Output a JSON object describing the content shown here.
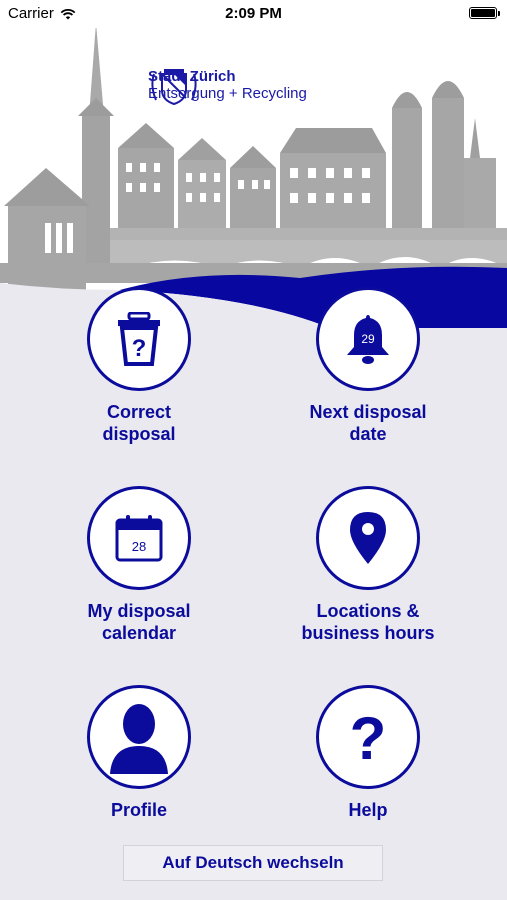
{
  "status_bar": {
    "carrier": "Carrier",
    "time": "2:09 PM"
  },
  "header": {
    "title": "Stadt Zürich",
    "subtitle": "Entsorgung + Recycling"
  },
  "tiles": [
    {
      "label": "Correct\ndisposal",
      "icon": "trash-question-icon"
    },
    {
      "label": "Next disposal\ndate",
      "icon": "bell-icon",
      "badge": "29"
    },
    {
      "label": "My disposal\ncalendar",
      "icon": "calendar-icon",
      "badge": "28"
    },
    {
      "label": "Locations &\nbusiness hours",
      "icon": "location-pin-icon"
    },
    {
      "label": "Profile",
      "icon": "person-icon"
    },
    {
      "label": "Help",
      "icon": "question-icon"
    }
  ],
  "language_button": "Auf Deutsch wechseln",
  "colors": {
    "brand_blue": "#0b0b9c",
    "background": "#e9e9ef",
    "skyline_gray": "#a6a6a6"
  }
}
